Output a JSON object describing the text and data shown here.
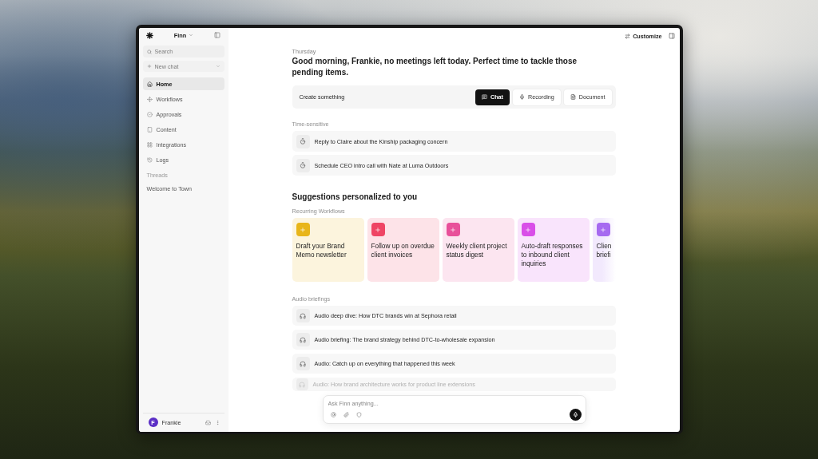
{
  "sidebar": {
    "workspace": "Finn",
    "search": {
      "placeholder": "Search"
    },
    "new_chat": "New chat",
    "nav": [
      {
        "label": "Home",
        "selected": true
      },
      {
        "label": "Workflows",
        "selected": false
      },
      {
        "label": "Approvals",
        "selected": false
      },
      {
        "label": "Content",
        "selected": false
      },
      {
        "label": "Integrations",
        "selected": false
      },
      {
        "label": "Logs",
        "selected": false
      }
    ],
    "threads": {
      "title": "Threads",
      "items": [
        {
          "label": "Welcome to Town",
          "selected": false
        }
      ]
    },
    "user": {
      "initial": "F",
      "name": "Frankie"
    }
  },
  "toolbar": {
    "customize": "Customize"
  },
  "home": {
    "day": "Thursday",
    "greeting": "Good morning, Frankie, no meetings left today. Perfect time to tackle those pending items.",
    "create": {
      "label": "Create something",
      "options": [
        {
          "label": "Chat",
          "selected": true
        },
        {
          "label": "Recording",
          "selected": false
        },
        {
          "label": "Document",
          "selected": false
        }
      ]
    },
    "time_sensitive": {
      "title": "Time-sensitive",
      "items": [
        "Reply to Claire about the Kinship packaging concern",
        "Schedule CEO intro call with Nate at Luma Outdoors"
      ]
    },
    "suggestions": {
      "title": "Suggestions personalized to you",
      "subtitle": "Recurring Workflows",
      "cards": [
        {
          "title": "Draft your Brand Memo newsletter",
          "color": "#e8b51a"
        },
        {
          "title": "Follow up on overdue client invoices",
          "color": "#ef4565"
        },
        {
          "title": "Weekly client project status digest",
          "color": "#e8509a"
        },
        {
          "title": "Auto-draft responses to inbound client inquiries",
          "color": "#d94ee8"
        },
        {
          "title": "Clien briefi",
          "color": "#a66af0"
        }
      ]
    },
    "audio_briefings": {
      "title": "Audio briefings",
      "items": [
        {
          "label": "Audio deep dive: How DTC brands win at Sephora retail",
          "dimmed": false
        },
        {
          "label": "Audio briefing: The brand strategy behind DTC-to-wholesale expansion",
          "dimmed": false
        },
        {
          "label": "Audio: Catch up on everything that happened this week",
          "dimmed": false
        },
        {
          "label": "Audio: How brand architecture works for product line extensions",
          "dimmed": true
        }
      ]
    }
  },
  "composer": {
    "placeholder": "Ask Finn anything..."
  }
}
